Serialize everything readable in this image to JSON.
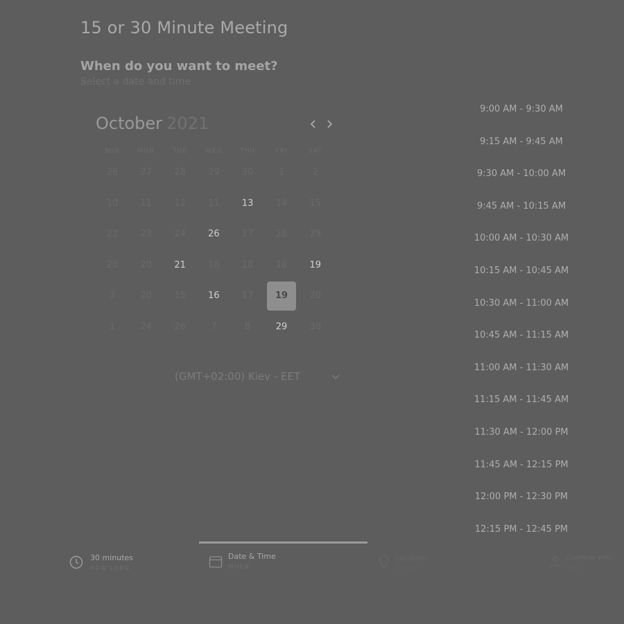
{
  "header": {
    "title": "15 or 30 Minute Meeting",
    "question": "When do you want to meet?",
    "subtitle": "Select a date and time"
  },
  "calendar": {
    "month": "October",
    "year": "2021",
    "prev_icon": "chevron-left-icon",
    "next_icon": "chevron-right-icon",
    "weekdays": [
      "SUN",
      "MON",
      "TUE",
      "WED",
      "THU",
      "FRI",
      "SAT"
    ],
    "weeks": [
      [
        "26",
        "27",
        "28",
        "29",
        "30",
        "1",
        "2"
      ],
      [
        "10",
        "11",
        "12",
        "11",
        "13",
        "14",
        "15"
      ],
      [
        "22",
        "23",
        "24",
        "26",
        "27",
        "28",
        "29"
      ],
      [
        "20",
        "20",
        "21",
        "18",
        "18",
        "18",
        "19"
      ],
      [
        "3",
        "20",
        "15",
        "16",
        "17",
        "19",
        "20"
      ],
      [
        "1",
        "24",
        "26",
        "7",
        "8",
        "29",
        "30"
      ]
    ],
    "available": [
      [
        1,
        4
      ],
      [
        2,
        3
      ],
      [
        3,
        2
      ],
      [
        3,
        6
      ],
      [
        4,
        3
      ],
      [
        5,
        5
      ]
    ],
    "selected": [
      4,
      5
    ],
    "timezone": "(GMT+02:00) Kiev - EET"
  },
  "time_slots": [
    "9:00 AM - 9:30 AM",
    "9:15 AM - 9:45 AM",
    "9:30 AM - 10:00 AM",
    "9:45 AM - 10:15 AM",
    "10:00 AM - 10:30 AM",
    "10:15 AM - 10:45 AM",
    "10:30 AM - 11:00 AM",
    "10:45 AM - 11:15 AM",
    "11:00 AM - 11:30 AM",
    "11:15 AM - 11:45 AM",
    "11:30 AM - 12:00 PM",
    "11:45 AM - 12:15 PM",
    "12:00 PM - 12:30 PM",
    "12:15 PM - 12:45 PM"
  ],
  "steps": [
    {
      "label": "30 minutes",
      "sub": "HOW LONG",
      "icon": "clock-icon"
    },
    {
      "label": "Date & Time",
      "sub": "WHEN",
      "icon": "calendar-icon"
    },
    {
      "label": "Location",
      "sub": "WHERE",
      "icon": "pin-icon"
    },
    {
      "label": "Confirm Info",
      "sub": "WHO",
      "icon": "person-icon"
    }
  ],
  "colors": {
    "overlay_bg": "#5d5d5d",
    "selected_day_bg": "#8e8e8e"
  }
}
